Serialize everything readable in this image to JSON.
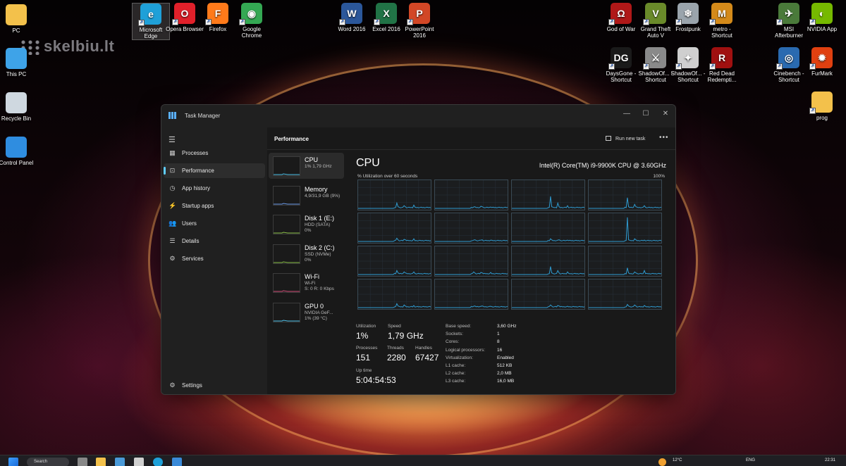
{
  "desktop": {
    "watermark": "skelbiu.lt",
    "icons_left": [
      {
        "label": "PC",
        "icon": "folder-icon",
        "color": "#f3c14b"
      },
      {
        "label": "This PC",
        "icon": "monitor-icon",
        "color": "#3ea3e8"
      },
      {
        "label": "Recycle Bin",
        "icon": "recycle-bin-icon",
        "color": "#cfd8e0"
      },
      {
        "label": "Control Panel",
        "icon": "control-panel-icon",
        "color": "#2f8de0"
      }
    ],
    "icons_top": [
      {
        "label": "Microsoft Edge",
        "icon": "edge-icon",
        "color": "#1fa0d8",
        "glyph": "e"
      },
      {
        "label": "Opera Browser",
        "icon": "opera-icon",
        "color": "#e0202a",
        "glyph": "O"
      },
      {
        "label": "Firefox",
        "icon": "firefox-icon",
        "color": "#ff7a1a",
        "glyph": "F"
      },
      {
        "label": "Google Chrome",
        "icon": "chrome-icon",
        "color": "#34a853",
        "glyph": "◉"
      },
      {
        "label": "Word 2016",
        "icon": "word-icon",
        "color": "#2b579a",
        "glyph": "W"
      },
      {
        "label": "Excel 2016",
        "icon": "excel-icon",
        "color": "#217346",
        "glyph": "X"
      },
      {
        "label": "PowerPoint 2016",
        "icon": "powerpoint-icon",
        "color": "#d24726",
        "glyph": "P"
      }
    ],
    "icons_right_row1": [
      {
        "label": "God of War",
        "icon": "god-of-war-icon",
        "color": "#b01818",
        "glyph": "Ω"
      },
      {
        "label": "Grand Theft Auto V",
        "icon": "gta-icon",
        "color": "#6a8a2a",
        "glyph": "V"
      },
      {
        "label": "Frostpunk",
        "icon": "frostpunk-icon",
        "color": "#9aa4ac",
        "glyph": "❄"
      },
      {
        "label": "metro - Shortcut",
        "icon": "metro-icon",
        "color": "#d48a1a",
        "glyph": "M"
      },
      {
        "label": "MSI Afterburner",
        "icon": "afterburner-icon",
        "color": "#4a7a3a",
        "glyph": "✈"
      },
      {
        "label": "NVIDIA App",
        "icon": "nvidia-icon",
        "color": "#76b900",
        "glyph": "◐"
      }
    ],
    "icons_right_row2": [
      {
        "label": "DaysGone - Shortcut",
        "icon": "days-gone-icon",
        "color": "#1a1a1a",
        "glyph": "DG"
      },
      {
        "label": "ShadowOf... - Shortcut",
        "icon": "shadow-of-war-icon",
        "color": "#8a8a8a",
        "glyph": "⚔"
      },
      {
        "label": "ShadowOf... - Shortcut",
        "icon": "shadow-of-tomb-raider-icon",
        "color": "#cfcfcf",
        "glyph": "✦"
      },
      {
        "label": "Red Dead Redempti...",
        "icon": "red-dead-icon",
        "color": "#a01010",
        "glyph": "R"
      },
      {
        "label": "Cinebench - Shortcut",
        "icon": "cinebench-icon",
        "color": "#2a6ab0",
        "glyph": "◎"
      },
      {
        "label": "FurMark",
        "icon": "furmark-icon",
        "color": "#e04010",
        "glyph": "✹"
      }
    ],
    "icons_right_row3": [
      {
        "label": "prog",
        "icon": "folder-icon",
        "color": "#f3c14b"
      }
    ]
  },
  "task_manager": {
    "title": "Task Manager",
    "window_buttons": {
      "minimize": "—",
      "maximize": "☐",
      "close": "✕"
    },
    "nav": [
      {
        "label": "Processes",
        "icon": "processes-icon",
        "glyph": "▦"
      },
      {
        "label": "Performance",
        "icon": "performance-icon",
        "glyph": "⊡",
        "active": true
      },
      {
        "label": "App history",
        "icon": "app-history-icon",
        "glyph": "◷"
      },
      {
        "label": "Startup apps",
        "icon": "startup-apps-icon",
        "glyph": "⚡"
      },
      {
        "label": "Users",
        "icon": "users-icon",
        "glyph": "👥"
      },
      {
        "label": "Details",
        "icon": "details-icon",
        "glyph": "☰"
      },
      {
        "label": "Services",
        "icon": "services-icon",
        "glyph": "⚙"
      }
    ],
    "settings_label": "Settings",
    "header": "Performance",
    "run_new_task": "Run new task",
    "more": "•••",
    "devices": [
      {
        "name": "CPU",
        "sub": [
          "1%  1,79 GHz"
        ],
        "active": true,
        "line": "#4fc1e9"
      },
      {
        "name": "Memory",
        "sub": [
          "4,9/31,9 GB (9%)"
        ],
        "line": "#6a9ae8"
      },
      {
        "name": "Disk 1 (E:)",
        "sub": [
          "HDD (SATA)",
          "0%"
        ],
        "line": "#8ac048"
      },
      {
        "name": "Disk 2 (C:)",
        "sub": [
          "SSD (NVMe)",
          "0%"
        ],
        "line": "#8ac048"
      },
      {
        "name": "Wi-Fi",
        "sub": [
          "Wi-Fi",
          "S: 0 R: 0 Kbps"
        ],
        "line": "#d4507a"
      },
      {
        "name": "GPU 0",
        "sub": [
          "NVIDIA GeF...",
          "1% (39 °C)"
        ],
        "line": "#4fc1e9"
      }
    ],
    "cpu": {
      "title": "CPU",
      "model": "Intel(R) Core(TM) i9-9900K CPU @ 3.60GHz",
      "util_label": "% Utilization over 60 seconds",
      "util_max": "100%",
      "graph_color": "#2f9bd0",
      "stats": {
        "utilization": {
          "label": "Utilization",
          "value": "1%"
        },
        "speed": {
          "label": "Speed",
          "value": "1,79 GHz"
        },
        "processes": {
          "label": "Processes",
          "value": "151"
        },
        "threads": {
          "label": "Threads",
          "value": "2280"
        },
        "handles": {
          "label": "Handles",
          "value": "67427"
        },
        "uptime": {
          "label": "Up time",
          "value": "5:04:54:53"
        }
      },
      "specs": [
        {
          "label": "Base speed:",
          "value": "3,60 GHz"
        },
        {
          "label": "Sockets:",
          "value": "1"
        },
        {
          "label": "Cores:",
          "value": "8"
        },
        {
          "label": "Logical processors:",
          "value": "16"
        },
        {
          "label": "Virtualization:",
          "value": "Enabled"
        },
        {
          "label": "L1 cache:",
          "value": "512 KB"
        },
        {
          "label": "L2 cache:",
          "value": "2,0 MB"
        },
        {
          "label": "L3 cache:",
          "value": "16,0 MB"
        }
      ],
      "core_spikes": [
        [
          0.2,
          0.1,
          0.12
        ],
        [
          0.05,
          0.08,
          0.05
        ],
        [
          0.45,
          0.2,
          0.1
        ],
        [
          0.4,
          0.15,
          0.1
        ],
        [
          0.12,
          0.08,
          0.1
        ],
        [
          0.05,
          0.05,
          0.05
        ],
        [
          0.1,
          0.05,
          0.05
        ],
        [
          0.9,
          0.1,
          0.05
        ],
        [
          0.15,
          0.1,
          0.1
        ],
        [
          0.1,
          0.08,
          0.08
        ],
        [
          0.3,
          0.15,
          0.1
        ],
        [
          0.25,
          0.1,
          0.15
        ],
        [
          0.15,
          0.1,
          0.08
        ],
        [
          0.05,
          0.05,
          0.05
        ],
        [
          0.1,
          0.08,
          0.05
        ],
        [
          0.12,
          0.1,
          0.08
        ]
      ]
    }
  },
  "taskbar": {
    "search_label": "Search",
    "weather": "12°C",
    "lang": "ENG",
    "time": "22:31"
  }
}
